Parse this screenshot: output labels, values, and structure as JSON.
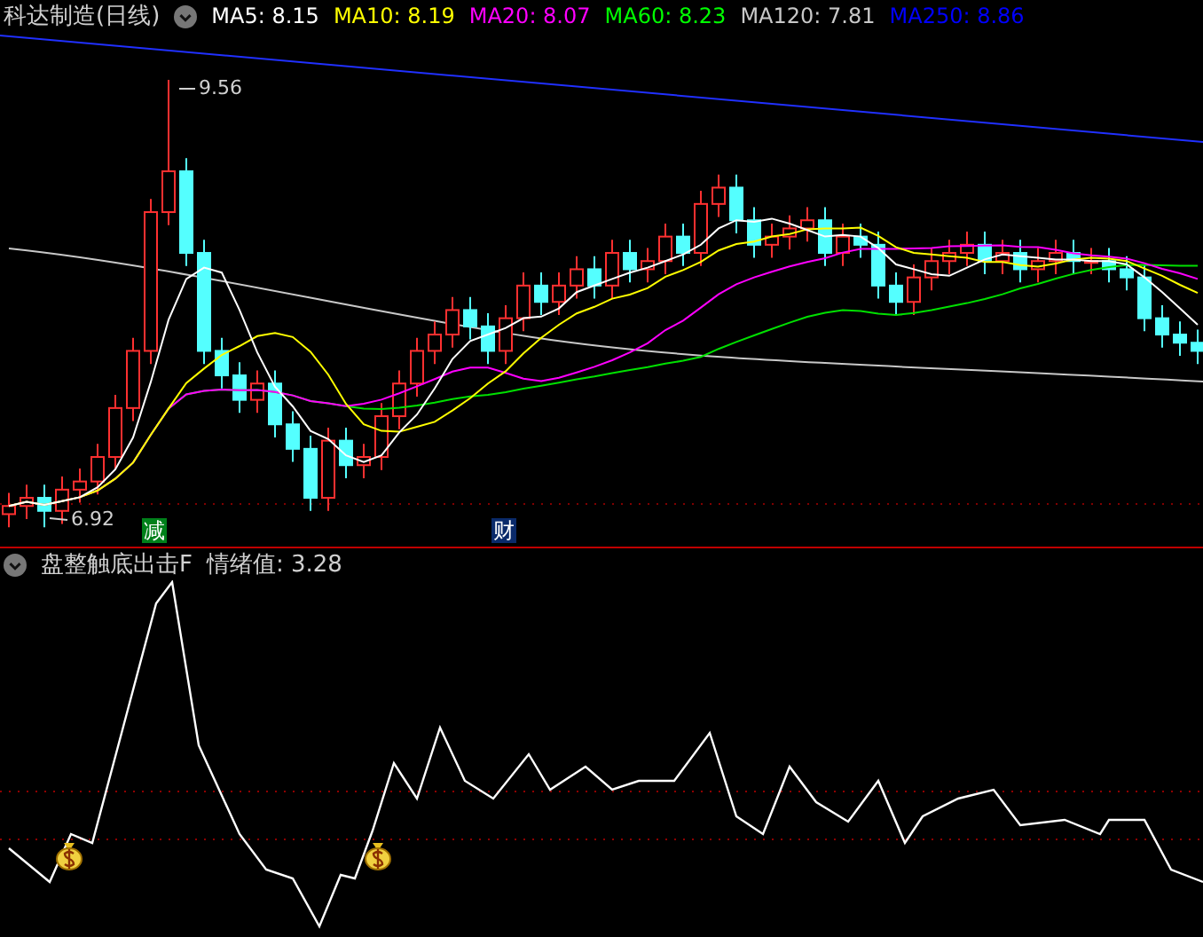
{
  "chart_header": {
    "title": "科达制造(日线)",
    "ma_readings": [
      {
        "text": "MA5: 8.15",
        "color": "#ffffff"
      },
      {
        "text": "MA10: 8.19",
        "color": "#ffff00"
      },
      {
        "text": "MA20: 8.07",
        "color": "#ff00ff"
      },
      {
        "text": "MA60: 8.23",
        "color": "#00ff00"
      },
      {
        "text": "MA120: 7.81",
        "color": "#c8c8c8"
      },
      {
        "text": "MA250: 8.86",
        "color": "#0000ff"
      }
    ]
  },
  "price_chart": {
    "high_label": "9.56",
    "low_label": "6.92",
    "markers": [
      {
        "text": "减",
        "color": "#00801a"
      },
      {
        "text": "财",
        "color": "#0a2a6a"
      }
    ]
  },
  "indicator_header": {
    "title": "盘整触底出击F",
    "reading": "情绪值: 3.28"
  }
}
